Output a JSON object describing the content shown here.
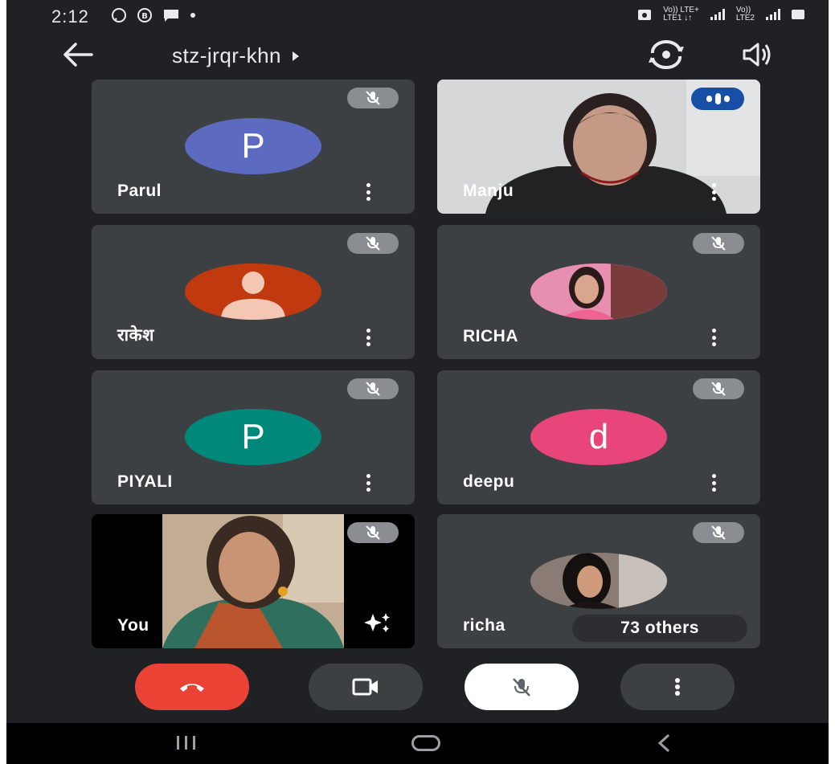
{
  "status_bar": {
    "time": "2:12",
    "network_text_1_top": "Vo)) LTE+",
    "network_text_1_bottom": "LTE1 ↓↑",
    "network_text_2_top": "Vo))",
    "network_text_2_bottom": "LTE2"
  },
  "header": {
    "meeting_code": "stz-jrqr-khn"
  },
  "tiles": [
    {
      "name": "Parul",
      "initial": "P",
      "avatar_color": "#5c6bc0",
      "muted": true
    },
    {
      "name": "Manju",
      "video": true,
      "speaking": true
    },
    {
      "name": "राकेश",
      "avatar_color": "#c0390f",
      "generic_avatar": true,
      "muted": true
    },
    {
      "name": "RICHA",
      "photo": true,
      "muted": true
    },
    {
      "name": "PIYALI",
      "initial": "P",
      "avatar_color": "#00897b",
      "muted": true
    },
    {
      "name": "deepu",
      "initial": "d",
      "avatar_color": "#e8457a",
      "muted": true
    },
    {
      "name": "You",
      "video": true,
      "self": true,
      "muted": true
    },
    {
      "name": "richa",
      "photo": true,
      "muted": true
    }
  ],
  "others_pill": "73 others",
  "colors": {
    "background": "#202124",
    "tile": "#3c4043",
    "end_call": "#ea4335",
    "speaking": "#174ea6"
  },
  "icons": {
    "back": "arrow-left-icon",
    "switch_camera": "switch-camera-icon",
    "speaker": "speaker-icon",
    "mic_off": "mic-off-icon",
    "more": "more-vert-icon",
    "end_call": "call-end-icon",
    "camera": "videocam-icon",
    "effects": "sparkle-effects-icon"
  }
}
